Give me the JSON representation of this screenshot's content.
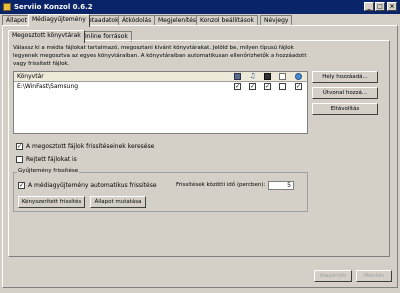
{
  "window": {
    "title": "Serviio Konzol 0.6.2"
  },
  "main_tabs": [
    "Állapot",
    "Médiagyűjtemény",
    "Metaadatok",
    "Átkódolás",
    "Megjelenítés",
    "Konzol beállítások",
    "Névjegy"
  ],
  "sub_tabs": [
    "Megosztott könyvtárak",
    "Online források"
  ],
  "description": "Válassz ki a média fájlokat tartalmazó, megosztani kívánt könyvtárakat. Jelöld be, milyen típusú fájlok legyenek megosztva az egyes könyvtáraiban. A könyvtáraiban automatikusan ellenőrizhetők a hozzáadott vagy frissített fájlok.",
  "library": {
    "column_title": "Könyvtár",
    "column_icons": [
      "video-icon",
      "music-icon",
      "image-icon",
      "file-icon",
      "globe-icon"
    ],
    "rows": [
      {
        "path": "E:\\WinFast\\Samsung",
        "checks": [
          true,
          true,
          true,
          false,
          true
        ]
      }
    ]
  },
  "side_buttons": {
    "add_folder": "Hely hozzáadá...",
    "add_path": "Útvonal hozzá...",
    "remove": "Eltávolítás"
  },
  "options": {
    "search_updates": "A megosztott fájlok frissítéseinek keresése",
    "search_updates_checked": true,
    "hidden_files": "Rejtett fájlokat is",
    "hidden_files_checked": false
  },
  "refresh_group": {
    "title": "Gyűjtemény frissítése",
    "auto_refresh": "A médiagyűjtemény automatikus frissítése",
    "auto_refresh_checked": true,
    "interval_label": "Frissítések közötti idő (percben):",
    "interval_value": "5",
    "force_refresh": "Kényszerített frissítés",
    "show_status": "Állapot mutatása"
  },
  "footer": {
    "save": "Alapérték",
    "cancel": "Mentés"
  }
}
